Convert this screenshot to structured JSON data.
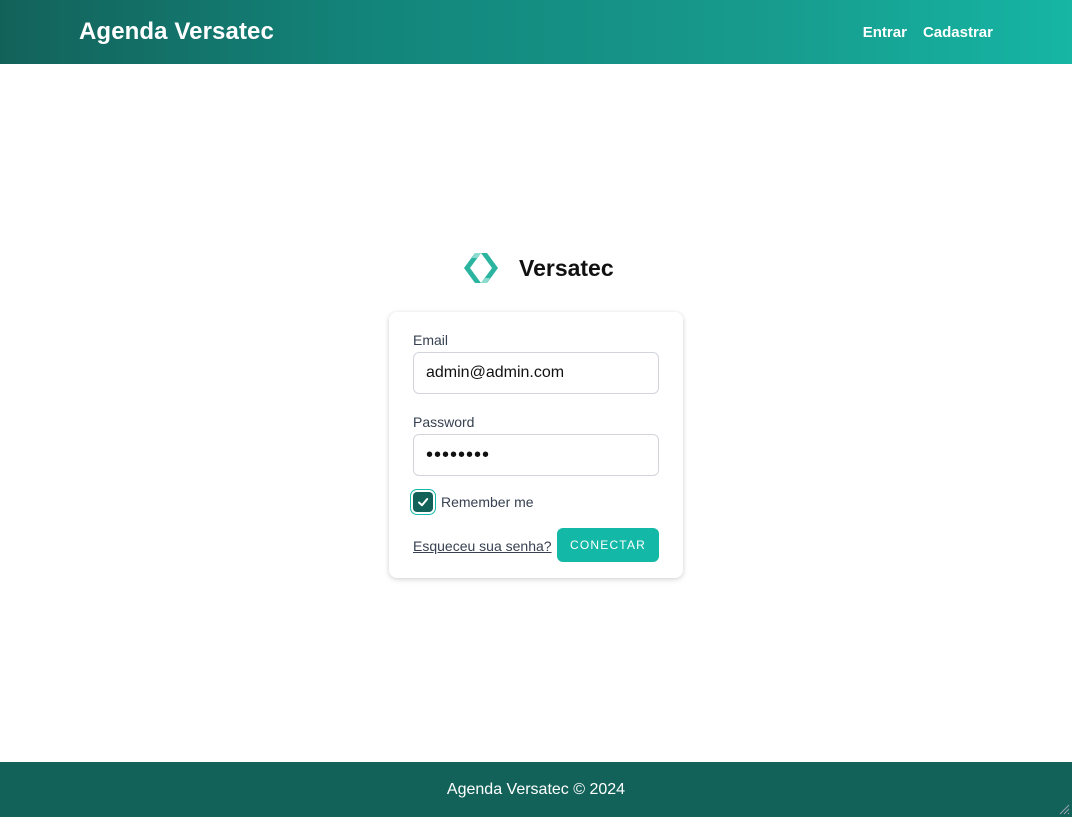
{
  "header": {
    "brand": "Agenda Versatec",
    "nav": [
      "Entrar",
      "Cadastrar"
    ]
  },
  "logo": {
    "icon": "code-brackets-icon",
    "text": "Versatec",
    "color": "#2bb5a0"
  },
  "form": {
    "email_label": "Email",
    "email_value": "admin@admin.com",
    "password_label": "Password",
    "password_value": "••••••••",
    "remember_label": "Remember me",
    "remember_checked": true,
    "forgot_link": "Esqueceu sua senha?",
    "submit_label": "CONECTAR"
  },
  "footer": {
    "text": "Agenda Versatec © 2024"
  },
  "colors": {
    "header_start": "#13625a",
    "header_end": "#16b5a4",
    "accent": "#14b8a6",
    "footer": "#13625a"
  }
}
